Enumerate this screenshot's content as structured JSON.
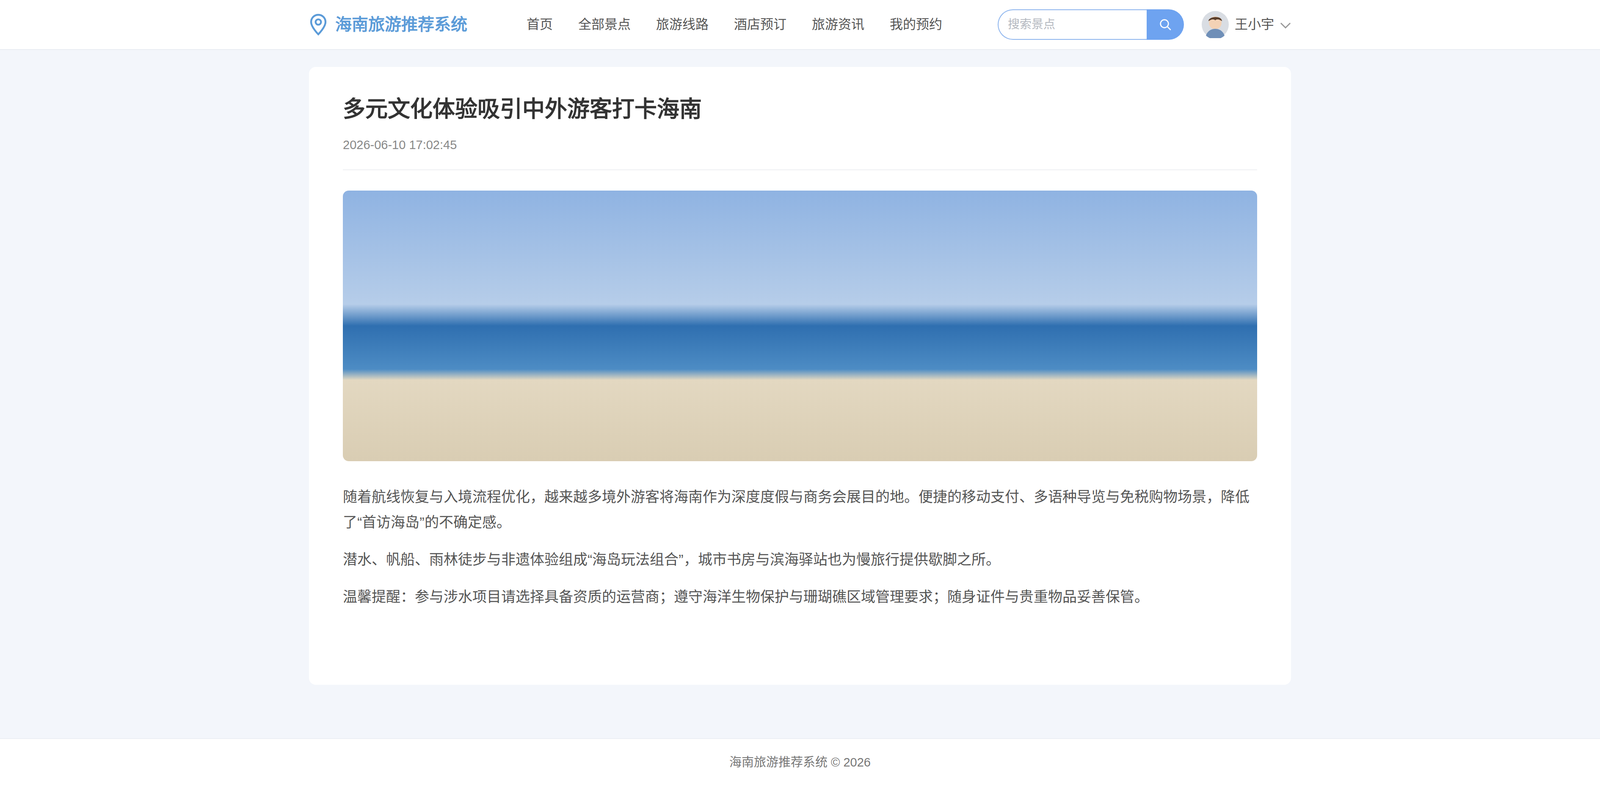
{
  "header": {
    "logo": "海南旅游推荐系统",
    "nav": [
      "首页",
      "全部景点",
      "旅游线路",
      "酒店预订",
      "旅游资讯",
      "我的预约"
    ],
    "search": {
      "placeholder": "搜索景点"
    },
    "user": "王小宇"
  },
  "article": {
    "title": "多元文化体验吸引中外游客打卡海南",
    "date": "2026-06-10 17:02:45",
    "paragraphs": [
      "随着航线恢复与入境流程优化，越来越多境外游客将海南作为深度度假与商务会展目的地。便捷的移动支付、多语种导览与免税购物场景，降低了“首访海岛”的不确定感。",
      "潜水、帆船、雨林徒步与非遗体验组成“海岛玩法组合”，城市书房与滨海驿站也为慢旅行提供歇脚之所。",
      "温馨提醒：参与涉水项目请选择具备资质的运营商；遵守海洋生物保护与珊瑚礁区域管理要求；随身证件与贵重物品妥善保管。"
    ]
  },
  "footer": "海南旅游推荐系统 © 2026"
}
